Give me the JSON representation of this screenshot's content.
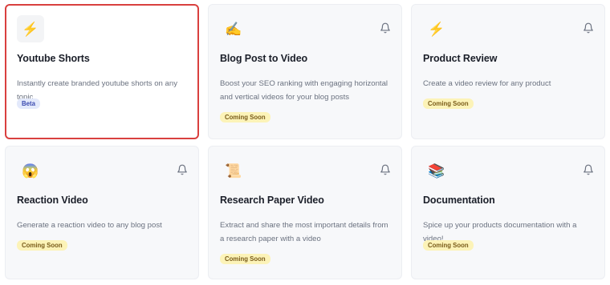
{
  "cards": [
    {
      "title": "Youtube Shorts",
      "description": "Instantly create branded youtube shorts on any topic",
      "badge": "Beta",
      "icon": "⚡",
      "icon_name": "lightning-icon"
    },
    {
      "title": "Blog Post to Video",
      "description": "Boost your SEO ranking with engaging horizontal and vertical videos for your blog posts",
      "badge": "Coming Soon",
      "icon": "✍️",
      "icon_name": "writing-hand-icon"
    },
    {
      "title": "Product Review",
      "description": "Create a video review for any product",
      "badge": "Coming Soon",
      "icon": "⚡",
      "icon_name": "lightning-icon"
    },
    {
      "title": "Reaction Video",
      "description": "Generate a reaction video to any blog post",
      "badge": "Coming Soon",
      "icon": "😱",
      "icon_name": "screaming-face-icon"
    },
    {
      "title": "Research Paper Video",
      "description": "Extract and share the most important details from a research paper with a video",
      "badge": "Coming Soon",
      "icon": "📜",
      "icon_name": "scroll-icon"
    },
    {
      "title": "Documentation",
      "description": "Spice up your products documentation with a video!",
      "badge": "Coming Soon",
      "icon": "📚",
      "icon_name": "books-icon"
    }
  ],
  "colors": {
    "selected_border": "#d9403f",
    "coming_soon_bg": "#fcf3b8",
    "beta_bg": "#e3e9fb"
  }
}
